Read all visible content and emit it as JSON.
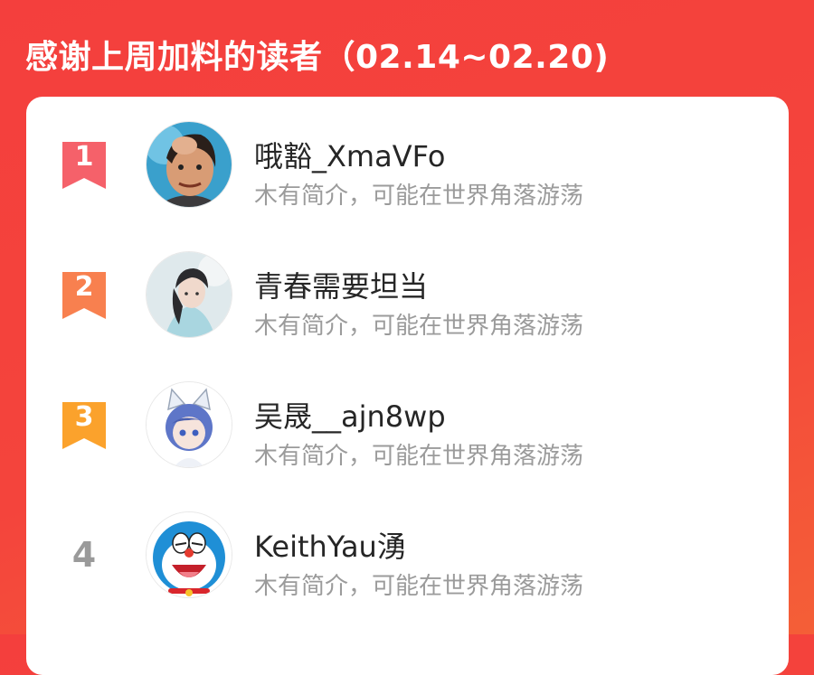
{
  "header": {
    "title": "感谢上周加料的读者（02.14~02.20)"
  },
  "colors": {
    "rank_1": "#f5616a",
    "rank_2": "#f8804f",
    "rank_3": "#fba22c",
    "rank_plain": "#9a9a9a"
  },
  "readers": [
    {
      "rank": "1",
      "name": "哦豁_XmaVFo",
      "bio": "木有简介，可能在世界角落游荡",
      "avatar": "avatar-cartoon-man"
    },
    {
      "rank": "2",
      "name": "青春需要坦当",
      "bio": "木有简介，可能在世界角落游荡",
      "avatar": "avatar-costume-portrait"
    },
    {
      "rank": "3",
      "name": "吴晟__ajn8wp",
      "bio": "木有简介，可能在世界角落游荡",
      "avatar": "avatar-anime-cat-ears"
    },
    {
      "rank": "4",
      "name": "KeithYau湧",
      "bio": "木有简介，可能在世界角落游荡",
      "avatar": "avatar-doraemon-crying"
    }
  ]
}
